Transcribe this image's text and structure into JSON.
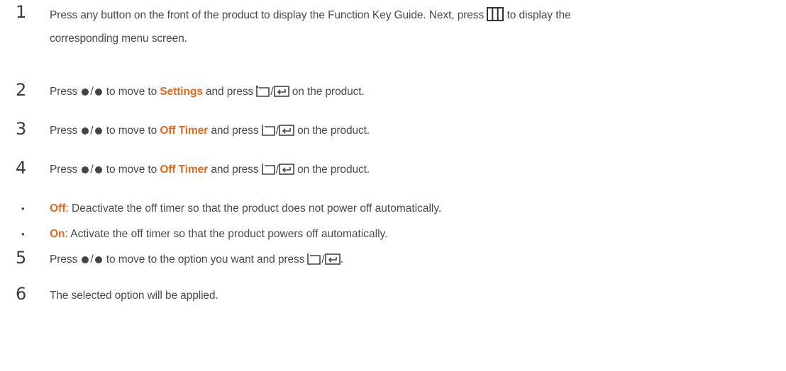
{
  "steps": [
    {
      "num": "1",
      "line1": {
        "pre": "Press any button on the front of the product to display the Function Key Guide. Next, press",
        "post": "to display the"
      },
      "line2": "corresponding menu screen."
    },
    {
      "num": "2",
      "press": "Press",
      "sep": "/",
      "move": "to move to",
      "target": "Settings",
      "and_press": "and press",
      "suffix": "on the product."
    },
    {
      "num": "3",
      "press": "Press",
      "sep": "/",
      "move": "to move to",
      "target": "Off Timer",
      "and_press": "and press",
      "suffix": "on the product."
    },
    {
      "num": "4",
      "press": "Press",
      "sep": "/",
      "move": "to move to",
      "target": "Off Timer",
      "and_press": "and press",
      "suffix": "on the product."
    },
    {
      "num": "5",
      "press": "Press",
      "sep": "/",
      "move": "to move to the option you want and press",
      "suffix": "."
    },
    {
      "num": "6",
      "text": "The selected option will be applied."
    }
  ],
  "bullets": [
    {
      "term": "Off",
      "desc": ": Deactivate the off timer so that the product does not power off automatically."
    },
    {
      "term": "On",
      "desc": ": Activate the off timer so that the product powers off automatically."
    }
  ],
  "icons": {
    "menu": "menu-grid-icon",
    "return": "return-icon",
    "enter": "enter-icon",
    "dot": "direction-dot-icon"
  },
  "colors": {
    "highlight": "#e06b1f",
    "text": "#4a4a4a"
  }
}
